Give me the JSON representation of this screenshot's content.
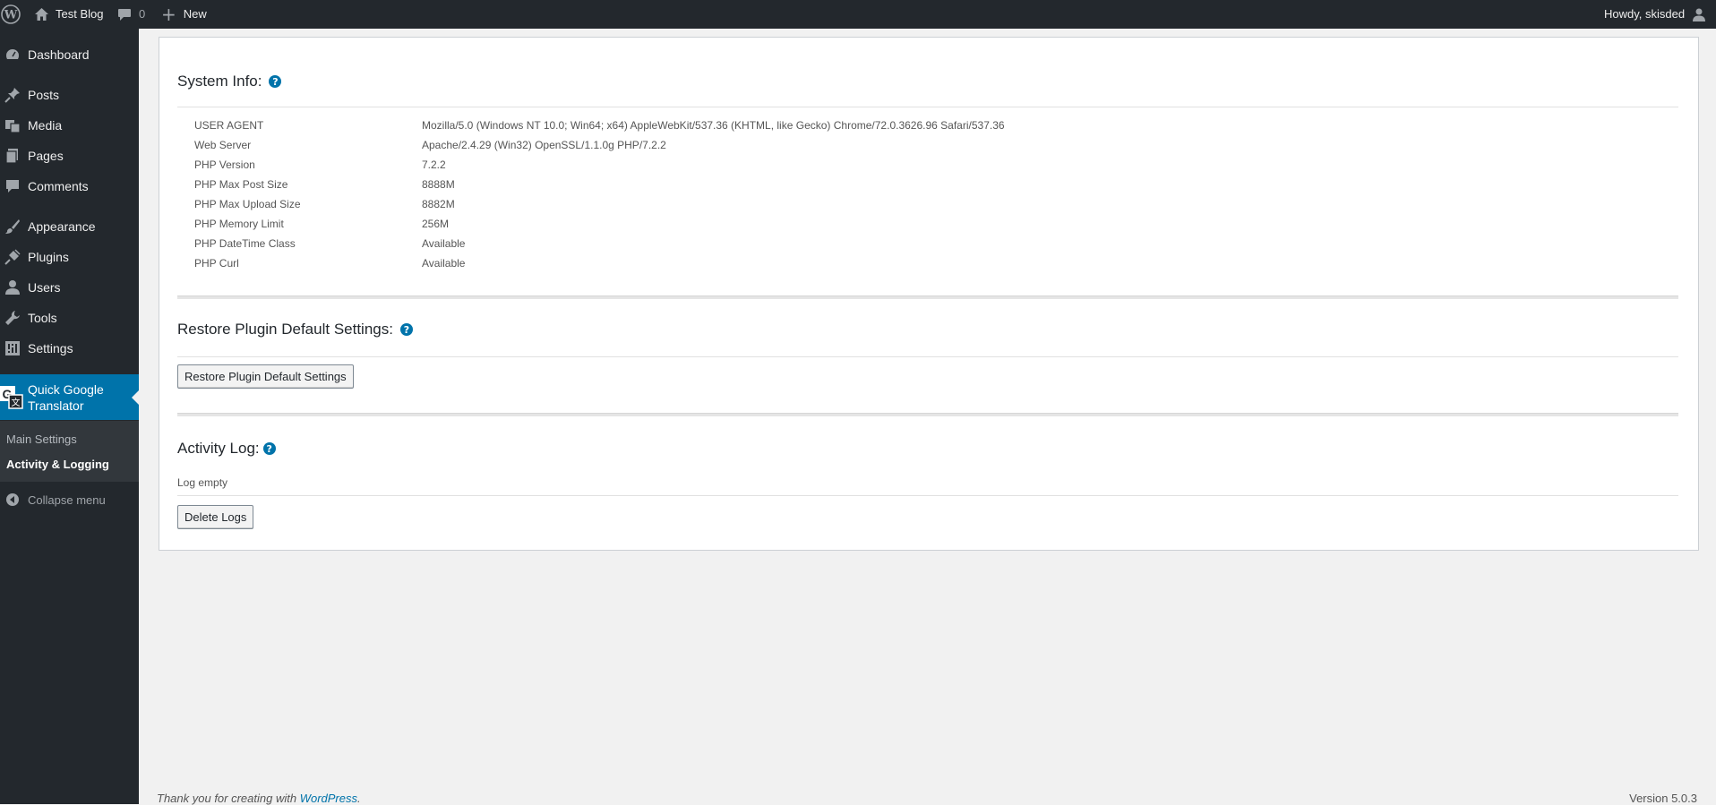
{
  "adminbar": {
    "site_name": "Test Blog",
    "comments_count": "0",
    "new_label": "New",
    "howdy": "Howdy, skisded"
  },
  "sidebar": {
    "items": [
      {
        "label": "Dashboard",
        "icon": "dashboard-icon"
      },
      {
        "label": "Posts",
        "icon": "pushpin-icon"
      },
      {
        "label": "Media",
        "icon": "media-icon"
      },
      {
        "label": "Pages",
        "icon": "pages-icon"
      },
      {
        "label": "Comments",
        "icon": "comment-icon"
      },
      {
        "label": "Appearance",
        "icon": "paintbrush-icon"
      },
      {
        "label": "Plugins",
        "icon": "plugin-icon"
      },
      {
        "label": "Users",
        "icon": "user-icon"
      },
      {
        "label": "Tools",
        "icon": "wrench-icon"
      },
      {
        "label": "Settings",
        "icon": "settings-icon"
      }
    ],
    "current": {
      "label_line1": "Quick Google",
      "label_line2": "Translator",
      "icon": "google-translate-icon",
      "icon_text_g": "G",
      "icon_text_x": "文"
    },
    "submenu": [
      {
        "label": "Main Settings"
      },
      {
        "label": "Activity & Logging"
      }
    ],
    "collapse_label": "Collapse menu"
  },
  "system_info": {
    "title": "System Info:",
    "help": "?",
    "rows": [
      {
        "key": "USER AGENT",
        "value": "Mozilla/5.0 (Windows NT 10.0; Win64; x64) AppleWebKit/537.36 (KHTML, like Gecko) Chrome/72.0.3626.96 Safari/537.36"
      },
      {
        "key": "Web Server",
        "value": "Apache/2.4.29 (Win32) OpenSSL/1.1.0g PHP/7.2.2"
      },
      {
        "key": "PHP Version",
        "value": "7.2.2"
      },
      {
        "key": "PHP Max Post Size",
        "value": "8888M"
      },
      {
        "key": "PHP Max Upload Size",
        "value": "8882M"
      },
      {
        "key": "PHP Memory Limit",
        "value": "256M"
      },
      {
        "key": "PHP DateTime Class",
        "value": "Available"
      },
      {
        "key": "PHP Curl",
        "value": "Available"
      }
    ]
  },
  "restore": {
    "title": "Restore Plugin Default Settings:",
    "help": "?",
    "button": "Restore Plugin Default Settings"
  },
  "activity": {
    "title": "Activity Log:",
    "help": "?",
    "empty_text": "Log empty",
    "button": "Delete Logs"
  },
  "footer": {
    "thanks_prefix": "Thank you for creating with ",
    "thanks_link": "WordPress",
    "thanks_suffix": ".",
    "version": "Version 5.0.3"
  },
  "colors": {
    "accent": "#0073aa",
    "adminbar": "#23282d",
    "submenu": "#32373c"
  }
}
